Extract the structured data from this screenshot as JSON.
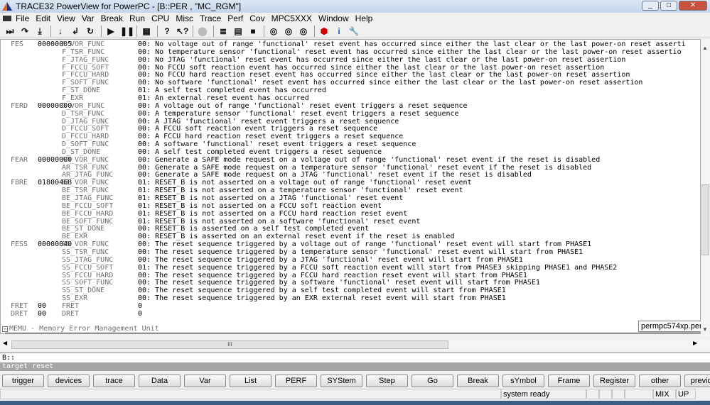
{
  "window": {
    "title": "TRACE32 PowerView for PowerPC - [B::PER , \"MC_RGM\"]"
  },
  "menu": [
    "File",
    "Edit",
    "View",
    "Var",
    "Break",
    "Run",
    "CPU",
    "Misc",
    "Trace",
    "Perf",
    "Cov",
    "MPC5XXX",
    "Window",
    "Help"
  ],
  "toolbar": [
    "step-icon",
    "step-over-icon",
    "step-into-icon",
    "down-icon",
    "return-icon",
    "redo-icon",
    "go-icon",
    "pause-icon",
    "chart-icon",
    "help-icon",
    "context-help-icon",
    "stop-icon",
    "list-icon",
    "register-icon",
    "memory-icon",
    "view1-icon",
    "view2-icon",
    "view3-icon",
    "bug-icon",
    "info-icon",
    "wrench-icon"
  ],
  "rows": [
    {
      "reg": "FES",
      "val": "00000005",
      "fld": "F_VOR_FUNC",
      "dsc": "00: No voltage out of range 'functional' reset event has occurred since either the last clear or the last power-on reset asserti"
    },
    {
      "reg": "",
      "val": "",
      "fld": "F_TSR_FUNC",
      "dsc": "00: No temperature sensor 'functional' reset event has occurred since either the last clear or the last power-on reset assertio"
    },
    {
      "reg": "",
      "val": "",
      "fld": "F_JTAG_FUNC",
      "dsc": "00: No JTAG 'functional' reset event has occurred since either the last clear or the last power-on reset assertion"
    },
    {
      "reg": "",
      "val": "",
      "fld": "F_FCCU_SOFT",
      "dsc": "00: No FCCU soft reaction event has occurred since either the last clear or the last power-on reset assertion"
    },
    {
      "reg": "",
      "val": "",
      "fld": "F_FCCU_HARD",
      "dsc": "00: No FCCU hard reaction reset event has occurred since either the last clear or the last power-on reset assertion"
    },
    {
      "reg": "",
      "val": "",
      "fld": "F_SOFT_FUNC",
      "dsc": "00: No software 'functional' reset event has occurred since either the last clear or the last power-on reset assertion"
    },
    {
      "reg": "",
      "val": "",
      "fld": "F_ST_DONE",
      "dsc": "01: A self test completed event has occurred"
    },
    {
      "reg": "",
      "val": "",
      "fld": "F_EXR",
      "dsc": "01: An external reset event has occurred"
    },
    {
      "reg": "FERD",
      "val": "00000000",
      "fld": "D_VOR_FUNC",
      "dsc": "00: A voltage out of range 'functional' reset event triggers a reset sequence"
    },
    {
      "reg": "",
      "val": "",
      "fld": "D_TSR_FUNC",
      "dsc": "00: A temperature sensor 'functional' reset event triggers a reset sequence"
    },
    {
      "reg": "",
      "val": "",
      "fld": "D_JTAG_FUNC",
      "dsc": "00: A JTAG 'functional' reset event triggers a reset sequence"
    },
    {
      "reg": "",
      "val": "",
      "fld": "D_FCCU_SOFT",
      "dsc": "00: A FCCU soft reaction event triggers a reset sequence"
    },
    {
      "reg": "",
      "val": "",
      "fld": "D_FCCU_HARD",
      "dsc": "00: A FCCU hard reaction reset event triggers a reset sequence"
    },
    {
      "reg": "",
      "val": "",
      "fld": "D_SOFT_FUNC",
      "dsc": "00: A software 'functional' reset event triggers a reset sequence"
    },
    {
      "reg": "",
      "val": "",
      "fld": "D_ST_DONE",
      "dsc": "00: A self test completed event triggers a reset sequence"
    },
    {
      "reg": "FEAR",
      "val": "00000000",
      "fld": "AR_VOR_FUNC",
      "dsc": "00: Generate a SAFE mode request on a voltage out of range 'functional' reset event if the reset is disabled"
    },
    {
      "reg": "",
      "val": "",
      "fld": "AR_TSR_FUNC",
      "dsc": "00: Generate a SAFE mode request on a temperature sensor 'functional' reset event if the reset is disabled"
    },
    {
      "reg": "",
      "val": "",
      "fld": "AR_JTAG_FUNC",
      "dsc": "00: Generate a SAFE mode request on a JTAG 'functional' reset event if the reset is disabled"
    },
    {
      "reg": "FBRE",
      "val": "01800468",
      "fld": "BE_VOR_FUNC",
      "dsc": "01: RESET_B is not asserted on a voltage out of range 'functional' reset event"
    },
    {
      "reg": "",
      "val": "",
      "fld": "BE_TSR_FUNC",
      "dsc": "01: RESET_B is not asserted on a temperature sensor 'functional' reset event"
    },
    {
      "reg": "",
      "val": "",
      "fld": "BE_JTAG_FUNC",
      "dsc": "01: RESET_B is not asserted on a JTAG 'functional' reset event"
    },
    {
      "reg": "",
      "val": "",
      "fld": "BE_FCCU_SOFT",
      "dsc": "01: RESET_B is not asserted on a FCCU soft reaction event"
    },
    {
      "reg": "",
      "val": "",
      "fld": "BE_FCCU_HARD",
      "dsc": "01: RESET_B is not asserted on a FCCU hard reaction reset event"
    },
    {
      "reg": "",
      "val": "",
      "fld": "BE_SOFT_FUNC",
      "dsc": "01: RESET_B is not asserted on a software 'functional' reset event"
    },
    {
      "reg": "",
      "val": "",
      "fld": "BE_ST_DONE",
      "dsc": "00: RESET_B is asserted on a self test completed event"
    },
    {
      "reg": "",
      "val": "",
      "fld": "BE_EXR",
      "dsc": "00: RESET_B is asserted on an external reset event if the reset is enabled"
    },
    {
      "reg": "FESS",
      "val": "00000040",
      "fld": "SS_VOR_FUNC",
      "dsc": "00: The reset sequence triggered by a voltage out of range 'functional' reset event will start from PHASE1"
    },
    {
      "reg": "",
      "val": "",
      "fld": "SS_TSR_FUNC",
      "dsc": "00: The reset sequence triggered by a temperature sensor 'functional' reset event will start from PHASE1"
    },
    {
      "reg": "",
      "val": "",
      "fld": "SS_JTAG_FUNC",
      "dsc": "00: The reset sequence triggered by a JTAG 'functional' reset event will start from PHASE1"
    },
    {
      "reg": "",
      "val": "",
      "fld": "SS_FCCU_SOFT",
      "dsc": "01: The reset sequence triggered by a FCCU soft reaction event will start from PHASE3 skipping PHASE1 and PHASE2"
    },
    {
      "reg": "",
      "val": "",
      "fld": "SS_FCCU_HARD",
      "dsc": "00: The reset sequence triggered by a FCCU hard reaction reset event will start from PHASE1"
    },
    {
      "reg": "",
      "val": "",
      "fld": "SS_SOFT_FUNC",
      "dsc": "00: The reset sequence triggered by a software 'functional' reset event will start from PHASE1"
    },
    {
      "reg": "",
      "val": "",
      "fld": "SS_ST_DONE",
      "dsc": "00: The reset sequence triggered by a self test completed event will start from PHASE1"
    },
    {
      "reg": "",
      "val": "",
      "fld": "SS_EXR",
      "dsc": "00: The reset sequence triggered by an EXR external reset event will start from PHASE1"
    },
    {
      "reg": "FRET",
      "val": "00",
      "fld": "FRET",
      "dsc": "0"
    },
    {
      "reg": "DRET",
      "val": "00",
      "fld": "DRET",
      "dsc": "0"
    }
  ],
  "memu": "MEMU - Memory Error Management Unit",
  "tooltip": "permpc574xp.per",
  "command": {
    "value": "B::",
    "message": "target reset"
  },
  "softkeys": [
    "trigger",
    "devices",
    "trace",
    "Data",
    "Var",
    "List",
    "PERF",
    "SYStem",
    "Step",
    "Go",
    "Break",
    "sYmbol",
    "Frame",
    "Register",
    "other",
    "previous"
  ],
  "status": {
    "text": "system ready",
    "mode": "MIX",
    "state": "UP"
  },
  "scroll_grip": "III"
}
